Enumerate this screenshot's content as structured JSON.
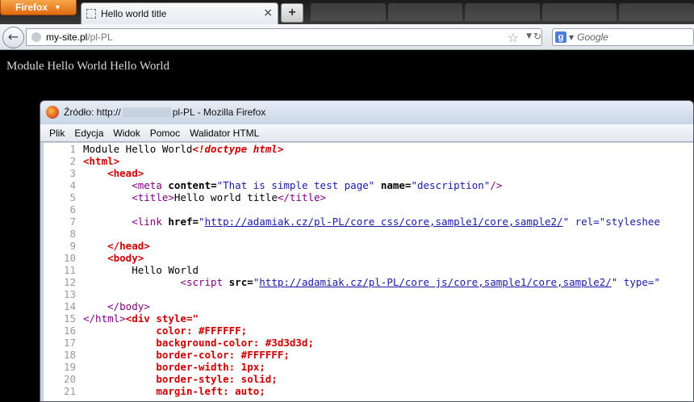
{
  "browser": {
    "menu_button": "Firefox",
    "tab_title": "Hello world title",
    "tab_close": "×",
    "newtab_label": "+",
    "url_host": "my-site.pl",
    "url_path": "/pl-PL",
    "search_placeholder": "Google"
  },
  "page": {
    "text": "Module Hello World Hello World"
  },
  "source_window": {
    "title": "Źródło: http://",
    "title_suffix": "pl-PL - Mozilla Firefox",
    "menu": [
      "Plik",
      "Edycja",
      "Widok",
      "Pomoc",
      "Walidator HTML"
    ],
    "code": {
      "l1_text": "Module Hello World",
      "l1_doctype": "<!doctype html>",
      "html_open": "<html>",
      "head_open": "<head>",
      "meta_tag": "<meta",
      "attr_content": "content=",
      "meta_content": "\"That is simple test page\"",
      "attr_name": "name=",
      "meta_name": "\"description\"",
      "meta_close": "/>",
      "title_open": "<title>",
      "title_text": "Hello world title",
      "title_close": "</title>",
      "link_tag": "<link",
      "attr_href": "href=",
      "link_href": "http://adamiak.cz/pl-PL/core css/core,sample1/core,sample2/",
      "link_rest": "\" rel=\"styleshee",
      "head_close": "</head>",
      "body_open": "<body>",
      "body_text": "Hello World",
      "script_tag": "<script",
      "attr_src": "src=",
      "script_src": "http://adamiak.cz/pl-PL/core js/core,sample1/core,sample2/",
      "script_rest": "\" type=\"",
      "body_close": "</body>",
      "html_close": "</html>",
      "div_style": "<div style=\"",
      "css_lines": [
        "color: #FFFFFF;",
        "background-color: #3d3d3d;",
        "border-color: #FFFFFF;",
        "border-width: 1px;",
        "border-style: solid;",
        "margin-left: auto;"
      ]
    }
  }
}
